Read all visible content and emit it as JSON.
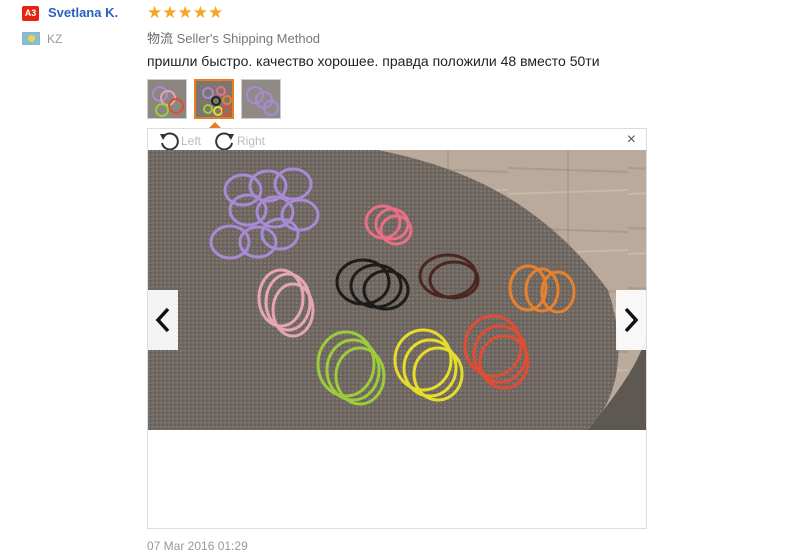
{
  "user": {
    "badge": "A3",
    "name": "Svetlana K.",
    "country": "KZ"
  },
  "review": {
    "rating": 5,
    "stars": "★★★★★",
    "shipping_label_cn": "物流",
    "shipping_method": "Seller's Shipping Method",
    "comment": "пришли быстро. качество хорошее. правда положили 48 вместо 50ти",
    "date": "07 Mar 2016 01:29"
  },
  "viewer": {
    "rotate_left": "Left",
    "rotate_right": "Right",
    "close": "×",
    "selected_thumbnail": 2
  },
  "colors": {
    "accent": "#e67e22",
    "username": "#2a5fbf",
    "star": "#f5a623",
    "badge": "#e6230e"
  }
}
